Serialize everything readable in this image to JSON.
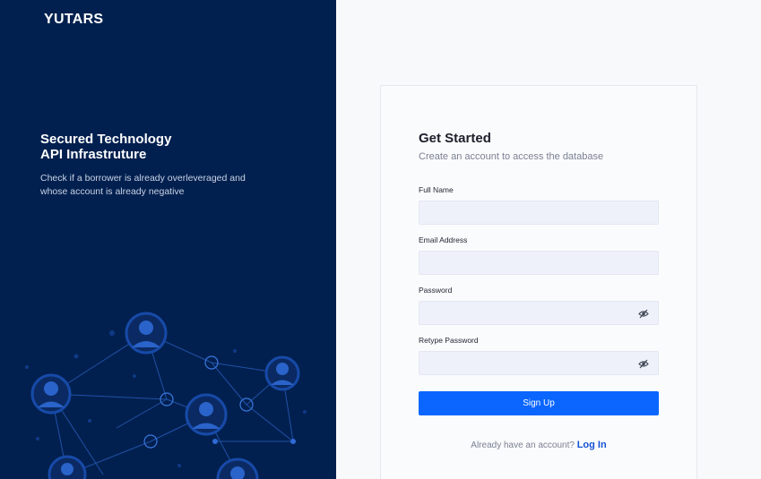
{
  "brand": {
    "logo": "YUTARS"
  },
  "hero": {
    "title_line1": "Secured Technology",
    "title_line2": "API Infrastruture",
    "description": "Check if a borrower is already overleveraged and whose account is already negative"
  },
  "form": {
    "title": "Get Started",
    "subtitle": "Create an account to access the database",
    "full_name_label": "Full Name",
    "full_name_value": "",
    "email_label": "Email Address",
    "email_value": "",
    "password_label": "Password",
    "password_value": "",
    "retype_label": "Retype Password",
    "retype_value": "",
    "submit_label": "Sign Up",
    "login_prompt": "Already have an account?",
    "login_link": "Log In"
  },
  "colors": {
    "left_panel": "#02204f",
    "primary": "#0a66ff",
    "link": "#1553d6"
  },
  "icons": [
    "people-network-illustration",
    "eye-off-icon"
  ]
}
